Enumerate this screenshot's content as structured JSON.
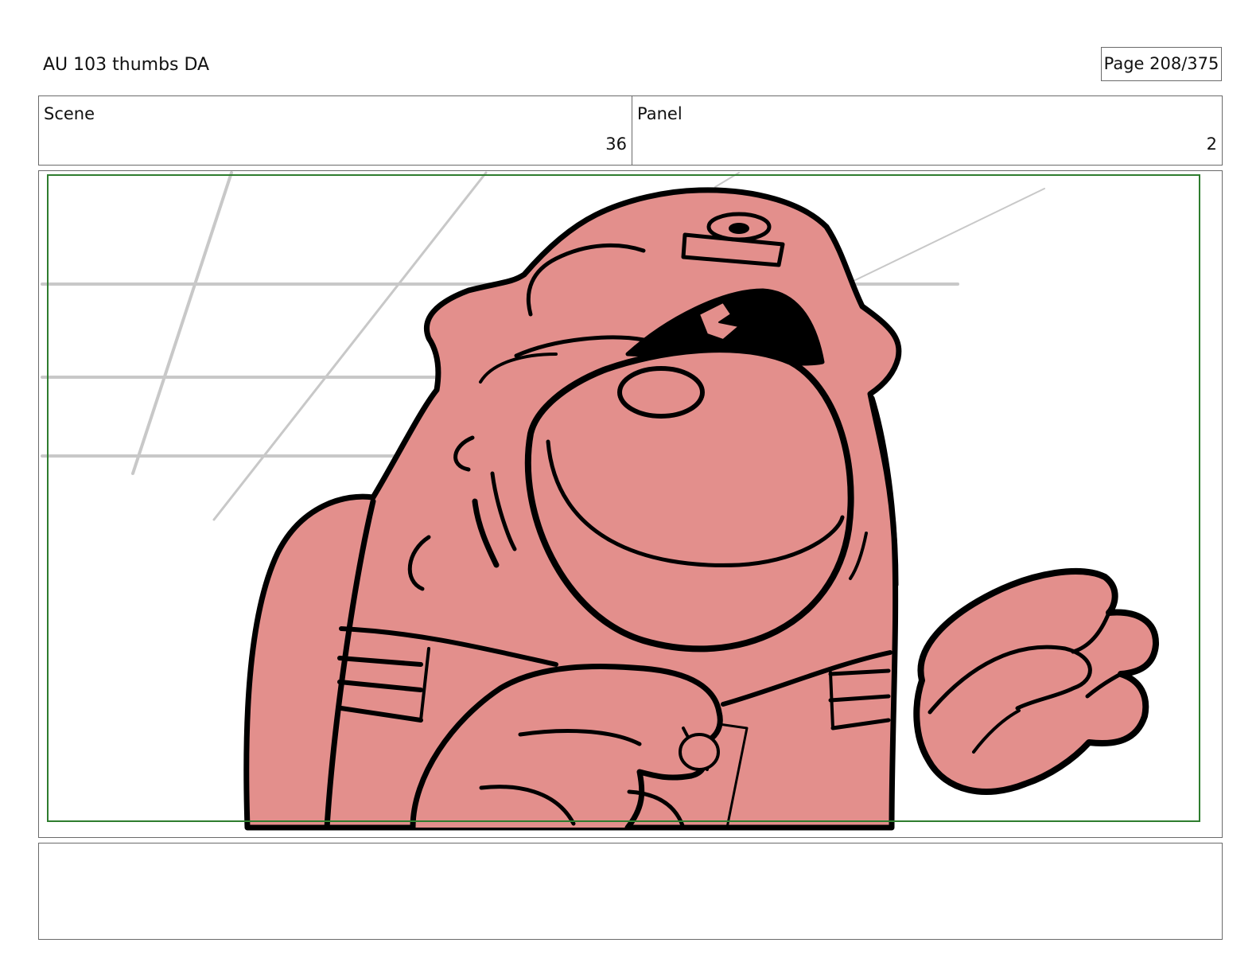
{
  "header": {
    "document_title": "AU 103 thumbs DA",
    "page_indicator": "Page 208/375"
  },
  "info": {
    "scene_label": "Scene",
    "scene_number": "36",
    "panel_label": "Panel",
    "panel_number": "2"
  },
  "drawing": {
    "subject": "storyboard-sketch",
    "colors": {
      "character_fill": "#e38f8c",
      "ink": "#000000",
      "background_lines": "#c8c8c8",
      "safe_frame": "#2e7d2e"
    }
  },
  "notes": {
    "text": ""
  }
}
